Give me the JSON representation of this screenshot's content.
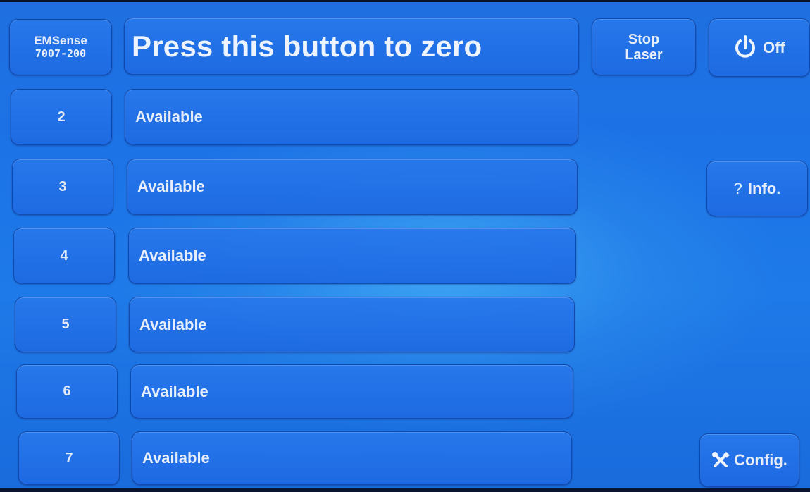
{
  "header": {
    "brand": {
      "name": "EMSense",
      "model": "7007-200"
    },
    "title": "Press this button to zero",
    "stop_laser": {
      "line1": "Stop",
      "line2": "Laser"
    },
    "off_label": "Off"
  },
  "side": {
    "info_symbol": "?",
    "info_label": "Info.",
    "config_label": "Config."
  },
  "slots": [
    {
      "number": "2",
      "status": "Available"
    },
    {
      "number": "3",
      "status": "Available"
    },
    {
      "number": "4",
      "status": "Available"
    },
    {
      "number": "5",
      "status": "Available"
    },
    {
      "number": "6",
      "status": "Available"
    },
    {
      "number": "7",
      "status": "Available"
    }
  ],
  "icons": {
    "power": "power-icon",
    "config": "tools-icon"
  },
  "colors": {
    "background": "#1e74e6",
    "button": "#2878eb",
    "text": "#e7eefa"
  }
}
